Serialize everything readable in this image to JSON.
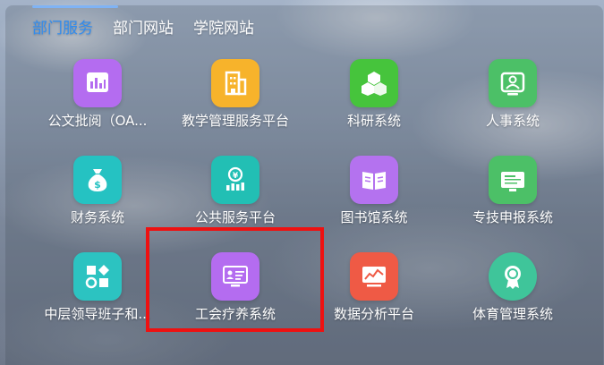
{
  "tabs": [
    {
      "label": "部门服务",
      "active": true
    },
    {
      "label": "部门网站",
      "active": false
    },
    {
      "label": "学院网站",
      "active": false
    }
  ],
  "apps": [
    {
      "label": "公文批阅（OA...",
      "icon": "document-chart-icon",
      "color": "#b46cf0"
    },
    {
      "label": "教学管理服务平台",
      "icon": "building-icon",
      "color": "#f7b32b"
    },
    {
      "label": "科研系统",
      "icon": "cubes-icon",
      "color": "#46c43c"
    },
    {
      "label": "人事系统",
      "icon": "person-card-icon",
      "color": "#4cc067"
    },
    {
      "label": "财务系统",
      "icon": "money-bag-icon",
      "color": "#25c2c2"
    },
    {
      "label": "公共服务平台",
      "icon": "yuan-chart-icon",
      "color": "#22bfb4"
    },
    {
      "label": "图书馆系统",
      "icon": "open-book-icon",
      "color": "#b472ef"
    },
    {
      "label": "专技申报系统",
      "icon": "certificate-icon",
      "color": "#4cc067"
    },
    {
      "label": "中层领导班子和...",
      "icon": "shapes-grid-icon",
      "color": "#2cc3c1"
    },
    {
      "label": "工会疗养系统",
      "icon": "monitor-profile-icon",
      "color": "#b46cf0"
    },
    {
      "label": "数据分析平台",
      "icon": "trend-chart-icon",
      "color": "#ef5a45"
    },
    {
      "label": "体育管理系统",
      "icon": "medal-icon",
      "color": "#3fc59a"
    }
  ],
  "highlight_color": "#ee1111"
}
